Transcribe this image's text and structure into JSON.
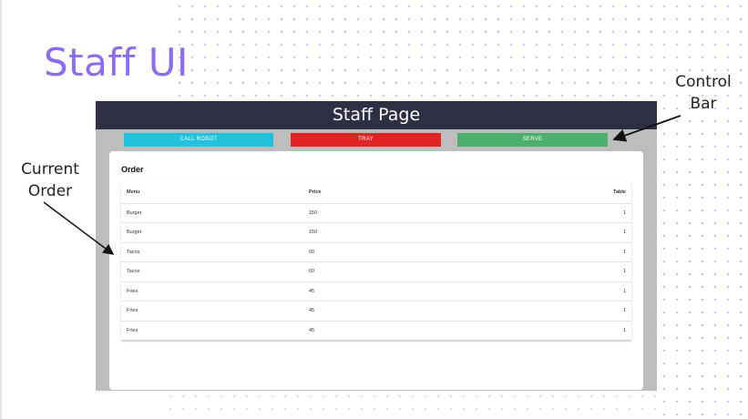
{
  "slide": {
    "title": "Staff UI",
    "annotations": {
      "control_bar": [
        "Control",
        "Bar"
      ],
      "current_order": [
        "Current",
        "Order"
      ]
    }
  },
  "app": {
    "header_title": "Staff Page",
    "control_bar": {
      "buttons": [
        {
          "label": "CALL ROBOT",
          "color": "#22c1dc"
        },
        {
          "label": "TRAY",
          "color": "#e02424"
        },
        {
          "label": "SERVE",
          "color": "#4caf6e"
        }
      ]
    },
    "order": {
      "title": "Order",
      "columns": [
        "Menu",
        "Price",
        "Table"
      ],
      "rows": [
        {
          "menu": "Burger",
          "price": "150",
          "table": "1"
        },
        {
          "menu": "Burger",
          "price": "150",
          "table": "1"
        },
        {
          "menu": "Tacos",
          "price": "60",
          "table": "1"
        },
        {
          "menu": "Tacos",
          "price": "60",
          "table": "1"
        },
        {
          "menu": "Fries",
          "price": "45",
          "table": "1"
        },
        {
          "menu": "Fries",
          "price": "45",
          "table": "1"
        },
        {
          "menu": "Fries",
          "price": "45",
          "table": "1"
        }
      ]
    }
  },
  "colors": {
    "title_accent": "#8c6cf0",
    "header_bg": "#2f2f44",
    "frame_bg": "#bdbdbd"
  }
}
